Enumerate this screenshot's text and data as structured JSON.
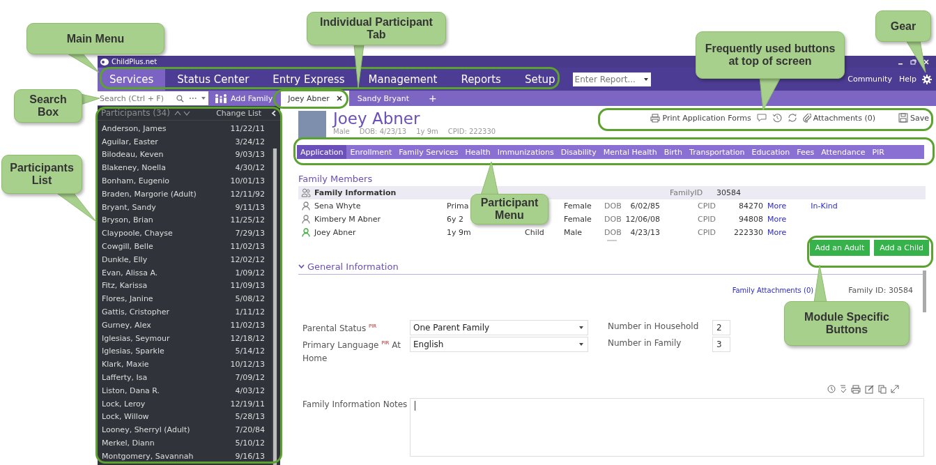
{
  "annotations": [
    {
      "text": "Main Menu"
    },
    {
      "text": "Individual Participant Tab"
    },
    {
      "text": "Frequently used buttons at top of screen"
    },
    {
      "text": "Gear"
    },
    {
      "text": "Search Box"
    },
    {
      "text": "Participants List"
    },
    {
      "text": "Participant Menu"
    },
    {
      "text": "Module Specific Buttons"
    }
  ],
  "window": {
    "title": "ChildPlus.net"
  },
  "main_menu": [
    {
      "label": "Services",
      "selected": true
    },
    {
      "label": "Status Center",
      "selected": false
    },
    {
      "label": "Entry Express",
      "selected": false
    },
    {
      "label": "Management",
      "selected": false
    },
    {
      "label": "Reports",
      "selected": false
    },
    {
      "label": "Setup",
      "selected": false
    }
  ],
  "report_field": {
    "placeholder": "Enter Report..."
  },
  "top_links": [
    "Community",
    "Help"
  ],
  "search": {
    "placeholder": "Search (Ctrl + F)"
  },
  "add_family": "Add Family",
  "participant_tabs": [
    {
      "label": "Joey Abner",
      "selected": true
    },
    {
      "label": "Sandy Bryant",
      "selected": false
    }
  ],
  "new_tab": "+",
  "participants": {
    "title": "Participants (34)",
    "change_list": "Change List",
    "rows": [
      {
        "name": "Anderson, James",
        "date": "11/22/11"
      },
      {
        "name": "Aguilar, Easter",
        "date": "3/24/12"
      },
      {
        "name": "Bilodeau, Keven",
        "date": "9/03/13"
      },
      {
        "name": "Blakeney, Noella",
        "date": "4/30/12"
      },
      {
        "name": "Bonham, Eugenio",
        "date": "10/01/13"
      },
      {
        "name": "Braden, Margorie (Adult)",
        "date": "12/11/92"
      },
      {
        "name": "Bryant, Sandy",
        "date": "9/11/13"
      },
      {
        "name": "Bryson, Brian",
        "date": "11/25/12"
      },
      {
        "name": "Claypoole, Chayse",
        "date": "7/29/13"
      },
      {
        "name": "Cowgill, Belle",
        "date": "11/02/13"
      },
      {
        "name": "Dunkle, Elly",
        "date": "12/02/12"
      },
      {
        "name": "Evan, Alissa A.",
        "date": "1/09/12"
      },
      {
        "name": "Fitz, Karissa",
        "date": "11/09/13"
      },
      {
        "name": "Flores, Janine",
        "date": "5/08/12"
      },
      {
        "name": "Gattis, Cristopher",
        "date": "1/11/12"
      },
      {
        "name": "Gurney, Alex",
        "date": "11/02/13"
      },
      {
        "name": "Iglesias, Seymour",
        "date": "12/18/12"
      },
      {
        "name": "Iglesias, Sparkle",
        "date": "5/14/12"
      },
      {
        "name": "Klark, Maxie",
        "date": "10/12/13"
      },
      {
        "name": "Lafferty, Isa",
        "date": "7/09/12"
      },
      {
        "name": "Liston, Dana R.",
        "date": "4/03/12"
      },
      {
        "name": "Lock, Leroy",
        "date": "12/19/11"
      },
      {
        "name": "Lock, Willow",
        "date": "5/28/13"
      },
      {
        "name": "Looney, Sherryl (Adult)",
        "date": "7/20/84"
      },
      {
        "name": "Merkel, Diann",
        "date": "5/10/12"
      },
      {
        "name": "Montgomery, Savannah",
        "date": "9/16/13"
      }
    ]
  },
  "participant": {
    "name": "Joey Abner",
    "gender": "Male",
    "dob": "DOB: 4/23/13",
    "age": "1y 9m",
    "cpid": "CPID: 222330"
  },
  "toolbar": {
    "print": "Print Application Forms",
    "attachments": "Attachments (0)",
    "save": "Save"
  },
  "participant_menu": [
    {
      "label": "Application",
      "selected": true
    },
    {
      "label": "Enrollment",
      "selected": false
    },
    {
      "label": "Family Services",
      "selected": false
    },
    {
      "label": "Health",
      "selected": false
    },
    {
      "label": "Immunizations",
      "selected": false
    },
    {
      "label": "Disability",
      "selected": false
    },
    {
      "label": "Mental Health",
      "selected": false
    },
    {
      "label": "Birth",
      "selected": false
    },
    {
      "label": "Transportation",
      "selected": false
    },
    {
      "label": "Education",
      "selected": false
    },
    {
      "label": "Fees",
      "selected": false
    },
    {
      "label": "Attendance",
      "selected": false
    },
    {
      "label": "PIR",
      "selected": false
    }
  ],
  "family_members": {
    "title": "Family Members",
    "info_row": {
      "label": "Family Information",
      "id_label": "FamilyID",
      "id": "30584"
    },
    "members": [
      {
        "name": "Sena Whyte",
        "relation": "Prima",
        "gender": "Female",
        "dob_label": "DOB",
        "dob": "6/02/85",
        "id_label": "CPID",
        "id": "84270",
        "more": "More",
        "extra": "In-Kind",
        "current": false
      },
      {
        "name": "Kimbery M Abner",
        "relation": "6y 2",
        "gender": "Female",
        "dob_label": "DOB",
        "dob": "12/06/08",
        "id_label": "CPID",
        "id": "94808",
        "more": "More",
        "current": false
      },
      {
        "name": "Joey Abner",
        "relation": "1y 9m",
        "type": "Child",
        "gender": "Male",
        "dob_label": "DOB",
        "dob": "4/23/13",
        "id_label": "CPID",
        "id": "222330",
        "more": "More",
        "current": true
      }
    ]
  },
  "family_buttons": [
    "Add an Adult",
    "Add a Child"
  ],
  "general_information": {
    "title": "General Information",
    "expanded": true,
    "attachments_link": "Family Attachments (0)",
    "family_id": "Family ID: 30584",
    "fields": [
      {
        "label": "Parental Status $^{PIR}$",
        "value": "One Parent Family",
        "side_label": "Number in Household",
        "side_value": "2"
      },
      {
        "label": "Primary Language $^{PIR}$ At Home",
        "value": "English",
        "side_label": "Number in Family",
        "side_value": "3"
      }
    ],
    "notes_label": "Family Information Notes"
  }
}
